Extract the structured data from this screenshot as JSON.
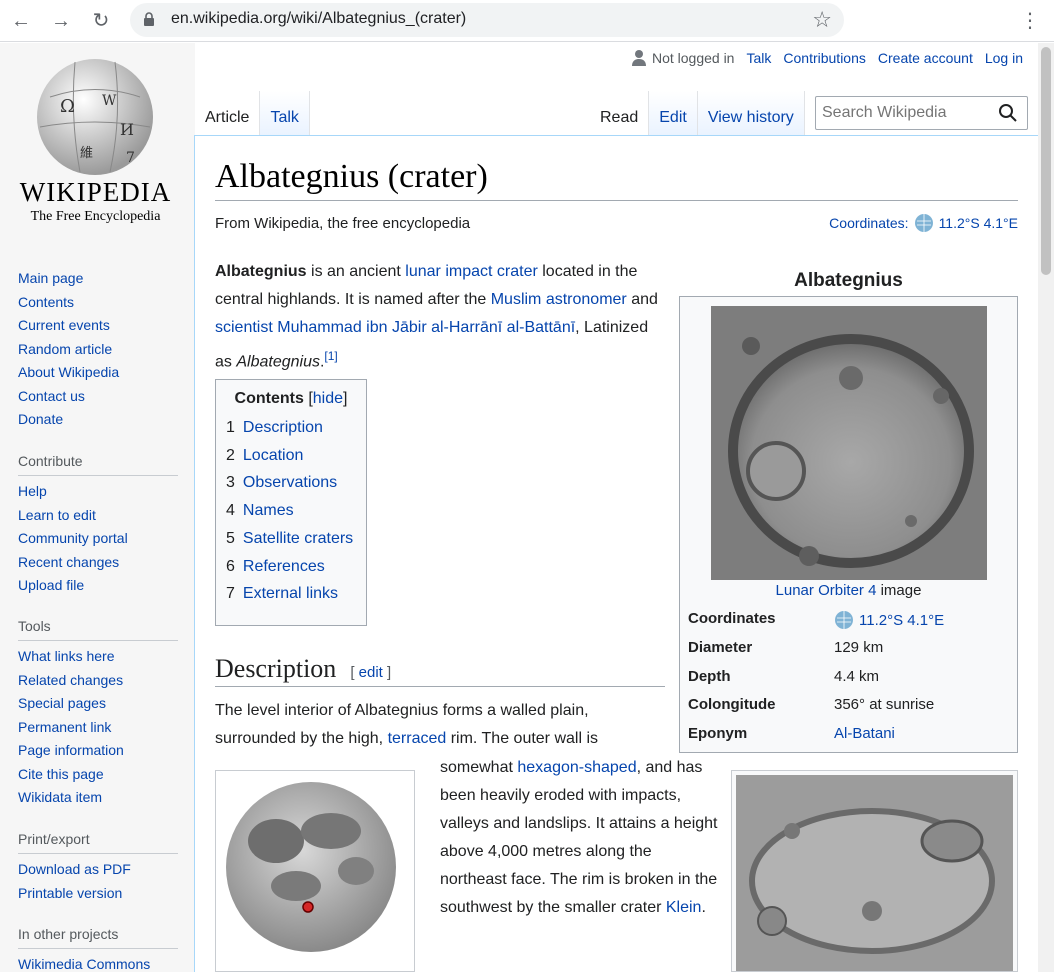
{
  "browser": {
    "url": "en.wikipedia.org/wiki/Albategnius_(crater)"
  },
  "logo": {
    "wordmark": "WIKIPEDIA",
    "tagline": "The Free Encyclopedia"
  },
  "sidebar": {
    "nav": [
      "Main page",
      "Contents",
      "Current events",
      "Random article",
      "About Wikipedia",
      "Contact us",
      "Donate"
    ],
    "contribute": {
      "heading": "Contribute",
      "items": [
        "Help",
        "Learn to edit",
        "Community portal",
        "Recent changes",
        "Upload file"
      ]
    },
    "tools": {
      "heading": "Tools",
      "items": [
        "What links here",
        "Related changes",
        "Special pages",
        "Permanent link",
        "Page information",
        "Cite this page",
        "Wikidata item"
      ]
    },
    "print": {
      "heading": "Print/export",
      "items": [
        "Download as PDF",
        "Printable version"
      ]
    },
    "other": {
      "heading": "In other projects",
      "items": [
        "Wikimedia Commons"
      ]
    }
  },
  "personal": {
    "not_logged": "Not logged in",
    "talk": "Talk",
    "contributions": "Contributions",
    "create": "Create account",
    "login": "Log in"
  },
  "tabs": {
    "article": "Article",
    "talk": "Talk",
    "read": "Read",
    "edit": "Edit",
    "history": "View history"
  },
  "search": {
    "placeholder": "Search Wikipedia"
  },
  "article": {
    "title": "Albategnius (crater)",
    "from": "From Wikipedia, the free encyclopedia",
    "coords_label": "Coordinates:",
    "coords_value": "11.2°S 4.1°E",
    "intro": {
      "bold": "Albategnius",
      "t1": " is an ancient ",
      "l1": "lunar impact crater",
      "t2": " located in the central highlands. It is named after the ",
      "l2": "Muslim astronomer",
      "t3": " and ",
      "l3": "scientist",
      "t4": " ",
      "l4": "Muhammad ibn Jābir al-Harrānī al-Battānī",
      "t5": ", Latinized as ",
      "ital": "Albategnius",
      "t6": ".",
      "ref": "[1]"
    },
    "toc": {
      "title": "Contents",
      "hide": "hide",
      "items": [
        {
          "n": "1",
          "label": "Description"
        },
        {
          "n": "2",
          "label": "Location"
        },
        {
          "n": "3",
          "label": "Observations"
        },
        {
          "n": "4",
          "label": "Names"
        },
        {
          "n": "5",
          "label": "Satellite craters"
        },
        {
          "n": "6",
          "label": "References"
        },
        {
          "n": "7",
          "label": "External links"
        }
      ]
    },
    "desc_heading": "Description",
    "edit_label": "edit",
    "desc1": {
      "t1": "The level interior of Albategnius forms a walled plain, surrounded by the high, ",
      "l1": "terraced",
      "t2": " rim. The outer wall is"
    },
    "desc2": {
      "t1": "somewhat ",
      "l1": "hexagon-shaped",
      "t2": ", and has been heavily eroded with impacts, valleys and landslips. It attains a height above 4,000 metres along the northeast face. The rim is broken in the southwest by the smaller crater ",
      "l2": "Klein",
      "t3": "."
    }
  },
  "infobox": {
    "caption": "Albategnius",
    "img_link": "Lunar Orbiter 4",
    "img_text": " image",
    "rows": [
      {
        "k": "Coordinates",
        "v": "11.2°S 4.1°E"
      },
      {
        "k": "Diameter",
        "v": "129 km"
      },
      {
        "k": "Depth",
        "v": "4.4 km"
      },
      {
        "k": "Colongitude",
        "v": "356° at sunrise"
      },
      {
        "k": "Eponym",
        "v": "Al-Batani"
      }
    ]
  },
  "colors": {
    "link": "#0645ad",
    "sidebar": "#f6f6f6",
    "border": "#a7d7f9"
  }
}
